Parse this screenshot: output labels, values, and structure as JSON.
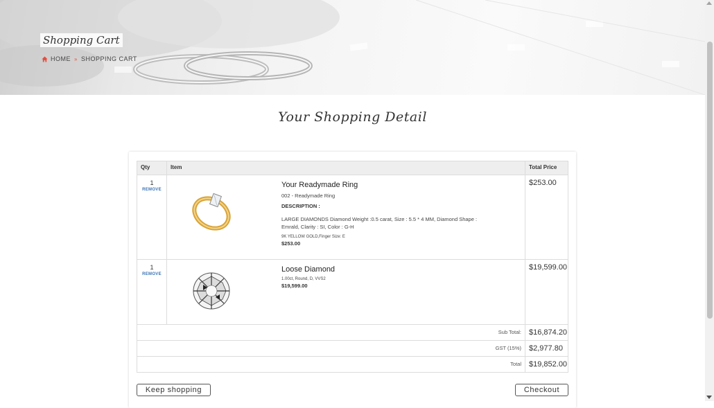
{
  "hero": {
    "title": "Shopping Cart",
    "breadcrumb": {
      "home": "HOME",
      "current": "SHOPPING CART"
    }
  },
  "heading": "Your Shopping Detail",
  "table": {
    "headers": {
      "qty": "Qty",
      "item": "Item",
      "total_price": "Total Price"
    },
    "rows": [
      {
        "qty": "1",
        "remove": "REMOVE",
        "image": "gold-solitaire-ring",
        "name": "Your Readymade Ring",
        "sku": "002 - Readymade Ring",
        "description_heading": "DESCRIPTION :",
        "description": "LARGE DIAMONDS Diamond Weight :0.5 carat, Size : 5.5 * 4 MM, Diamond Shape : Emrald, Clarity : SI, Color : G-H",
        "metal": "9K YELLOW GOLD,Finger Size: E",
        "price": "$253.00",
        "total": "$253.00"
      },
      {
        "qty": "1",
        "remove": "REMOVE",
        "image": "round-loose-diamond",
        "name": "Loose Diamond",
        "spec": "1.00ct, Round, D, VVS2",
        "price": "$19,599.00",
        "total": "$19,599.00"
      }
    ],
    "summary": {
      "subtotal_label": "Sub Total:",
      "subtotal": "$16,874.20",
      "gst_label": "GST (15%)",
      "gst": "$2,977.80",
      "total_label": "Total",
      "total": "$19,852.00"
    }
  },
  "buttons": {
    "keep_shopping": "Keep shopping",
    "checkout": "Checkout"
  },
  "colors": {
    "accent_link": "#3a73b5",
    "breadcrumb_separator": "#e74c3c",
    "gold": "#d9a43a"
  }
}
